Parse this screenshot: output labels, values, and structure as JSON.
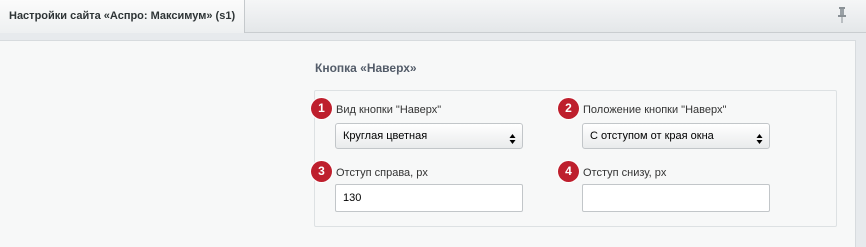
{
  "tab": {
    "title": "Настройки сайта «Аспро: Максимум» (s1)",
    "pin_icon": "pin-icon"
  },
  "section": {
    "title": "Кнопка «Наверх»"
  },
  "fields": [
    {
      "number": "1",
      "label": "Вид кнопки \"Наверх\"",
      "type": "select",
      "value": "Круглая цветная"
    },
    {
      "number": "2",
      "label": "Положение кнопки \"Наверх\"",
      "type": "select",
      "value": "С отступом от края окна"
    },
    {
      "number": "3",
      "label": "Отступ справа, px",
      "type": "input",
      "value": "130"
    },
    {
      "number": "4",
      "label": "Отступ снизу, px",
      "type": "input",
      "value": ""
    }
  ],
  "colors": {
    "badge": "#be1f2d",
    "section_title": "#535c69"
  }
}
